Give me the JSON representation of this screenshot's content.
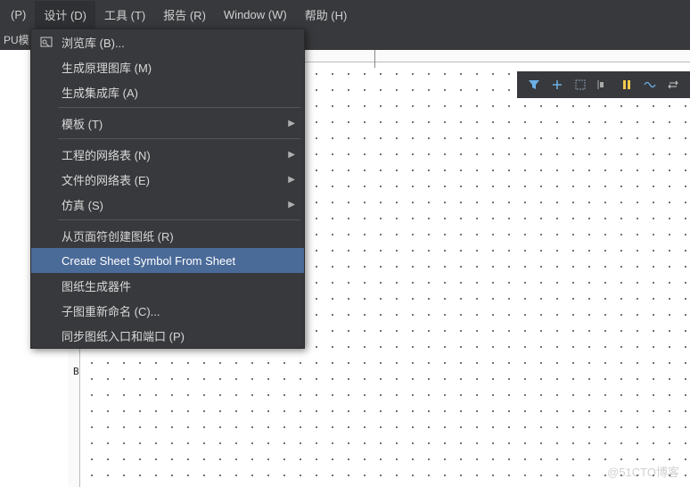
{
  "menubar": {
    "prev": "(P)",
    "items": [
      {
        "label": "设计 (D)",
        "active": true
      },
      {
        "label": "工具 (T)"
      },
      {
        "label": "报告 (R)"
      },
      {
        "label": "Window (W)"
      },
      {
        "label": "帮助 (H)"
      }
    ]
  },
  "subbar": {
    "text": "PU模"
  },
  "dropdown": {
    "items": [
      {
        "label": "浏览库 (B)...",
        "icon": "library"
      },
      {
        "label": "生成原理图库 (M)"
      },
      {
        "label": "生成集成库 (A)"
      },
      {
        "sep": true
      },
      {
        "label": "模板 (T)",
        "arrow": true
      },
      {
        "sep": true
      },
      {
        "label": "工程的网络表 (N)",
        "arrow": true
      },
      {
        "label": "文件的网络表 (E)",
        "arrow": true
      },
      {
        "label": "仿真 (S)",
        "arrow": true
      },
      {
        "sep": true
      },
      {
        "label": "从页面符创建图纸 (R)"
      },
      {
        "label": "Create Sheet Symbol From Sheet",
        "highlight": true
      },
      {
        "label": "图纸生成器件"
      },
      {
        "label": "子图重新命名 (C)..."
      },
      {
        "label": "同步图纸入口和端口 (P)"
      }
    ]
  },
  "canvas": {
    "row_label": "B"
  },
  "toolbar": {
    "icons": [
      "filter-icon",
      "plus-icon",
      "box-icon",
      "align-icon",
      "stack-icon",
      "wave-icon",
      "switch-icon"
    ]
  },
  "watermark": "@51CTO博客"
}
